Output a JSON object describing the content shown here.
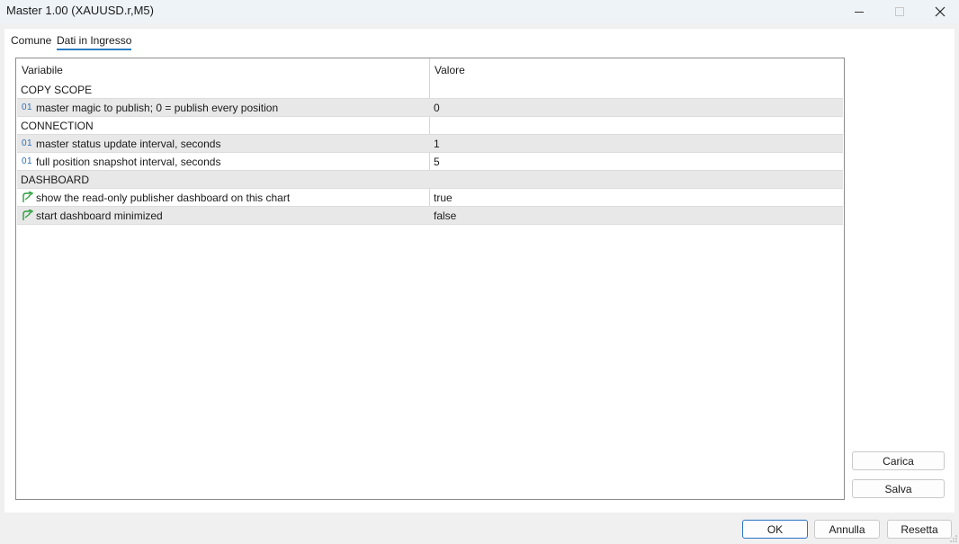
{
  "window": {
    "title": "Master 1.00 (XAUUSD.r,M5)"
  },
  "tabs": [
    {
      "label": "Comune"
    },
    {
      "label": "Dati in Ingresso"
    }
  ],
  "grid": {
    "headers": {
      "variable": "Variabile",
      "value": "Valore"
    },
    "rows": [
      {
        "type": "group",
        "label": "COPY SCOPE",
        "value": ""
      },
      {
        "type": "int",
        "icon": "01",
        "label": "master magic to publish; 0 = publish every position",
        "value": "0"
      },
      {
        "type": "group",
        "label": "CONNECTION",
        "value": ""
      },
      {
        "type": "int",
        "icon": "01",
        "label": "master status update interval, seconds",
        "value": "1"
      },
      {
        "type": "int",
        "icon": "01",
        "label": "full position snapshot interval, seconds",
        "value": "5"
      },
      {
        "type": "group",
        "label": "DASHBOARD",
        "value": ""
      },
      {
        "type": "bool",
        "icon": "bool-arrow-icon",
        "label": "show the read-only publisher dashboard on this chart",
        "value": "true"
      },
      {
        "type": "bool",
        "icon": "bool-arrow-icon",
        "label": "start dashboard minimized",
        "value": "false"
      }
    ]
  },
  "side_buttons": {
    "load": "Carica",
    "save": "Salva"
  },
  "footer_buttons": {
    "ok": "OK",
    "cancel": "Annulla",
    "reset": "Resetta"
  },
  "colors": {
    "accent": "#2f7ec1",
    "row_shade": "#e8e8e8",
    "int_icon": "#2f6fb6",
    "bool_icon": "#2e9e3e"
  }
}
